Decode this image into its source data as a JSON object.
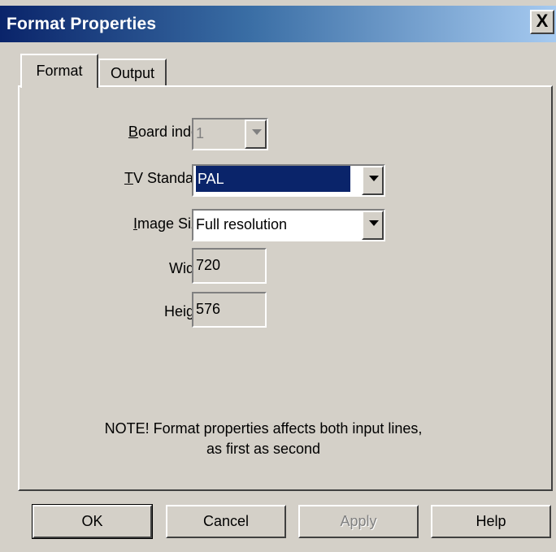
{
  "window": {
    "title": "Format Properties",
    "close_label": "X"
  },
  "tabs": [
    {
      "label": "Format",
      "selected": true
    },
    {
      "label": "Output",
      "selected": false
    }
  ],
  "form": {
    "board_index": {
      "label_prefix": "",
      "label_accel": "B",
      "label_rest": "oard index",
      "value": "1",
      "enabled": false
    },
    "tv_standard": {
      "label_accel": "T",
      "label_rest": "V Standard",
      "value": "PAL",
      "enabled": true
    },
    "image_size": {
      "label_accel": "I",
      "label_rest": "mage Size",
      "value": "Full resolution",
      "enabled": true
    },
    "width": {
      "label": "Width",
      "value": "720"
    },
    "height": {
      "label": "Height",
      "value": "576"
    }
  },
  "note": {
    "line1": "NOTE! Format properties affects both input lines,",
    "line2": "as first as second"
  },
  "buttons": {
    "ok": "OK",
    "cancel": "Cancel",
    "apply": "Apply",
    "help": "Help"
  },
  "colors": {
    "titlebar_start": "#0a246a",
    "titlebar_end": "#a6caf0",
    "face": "#d4d0c8",
    "selection": "#0a246a"
  }
}
